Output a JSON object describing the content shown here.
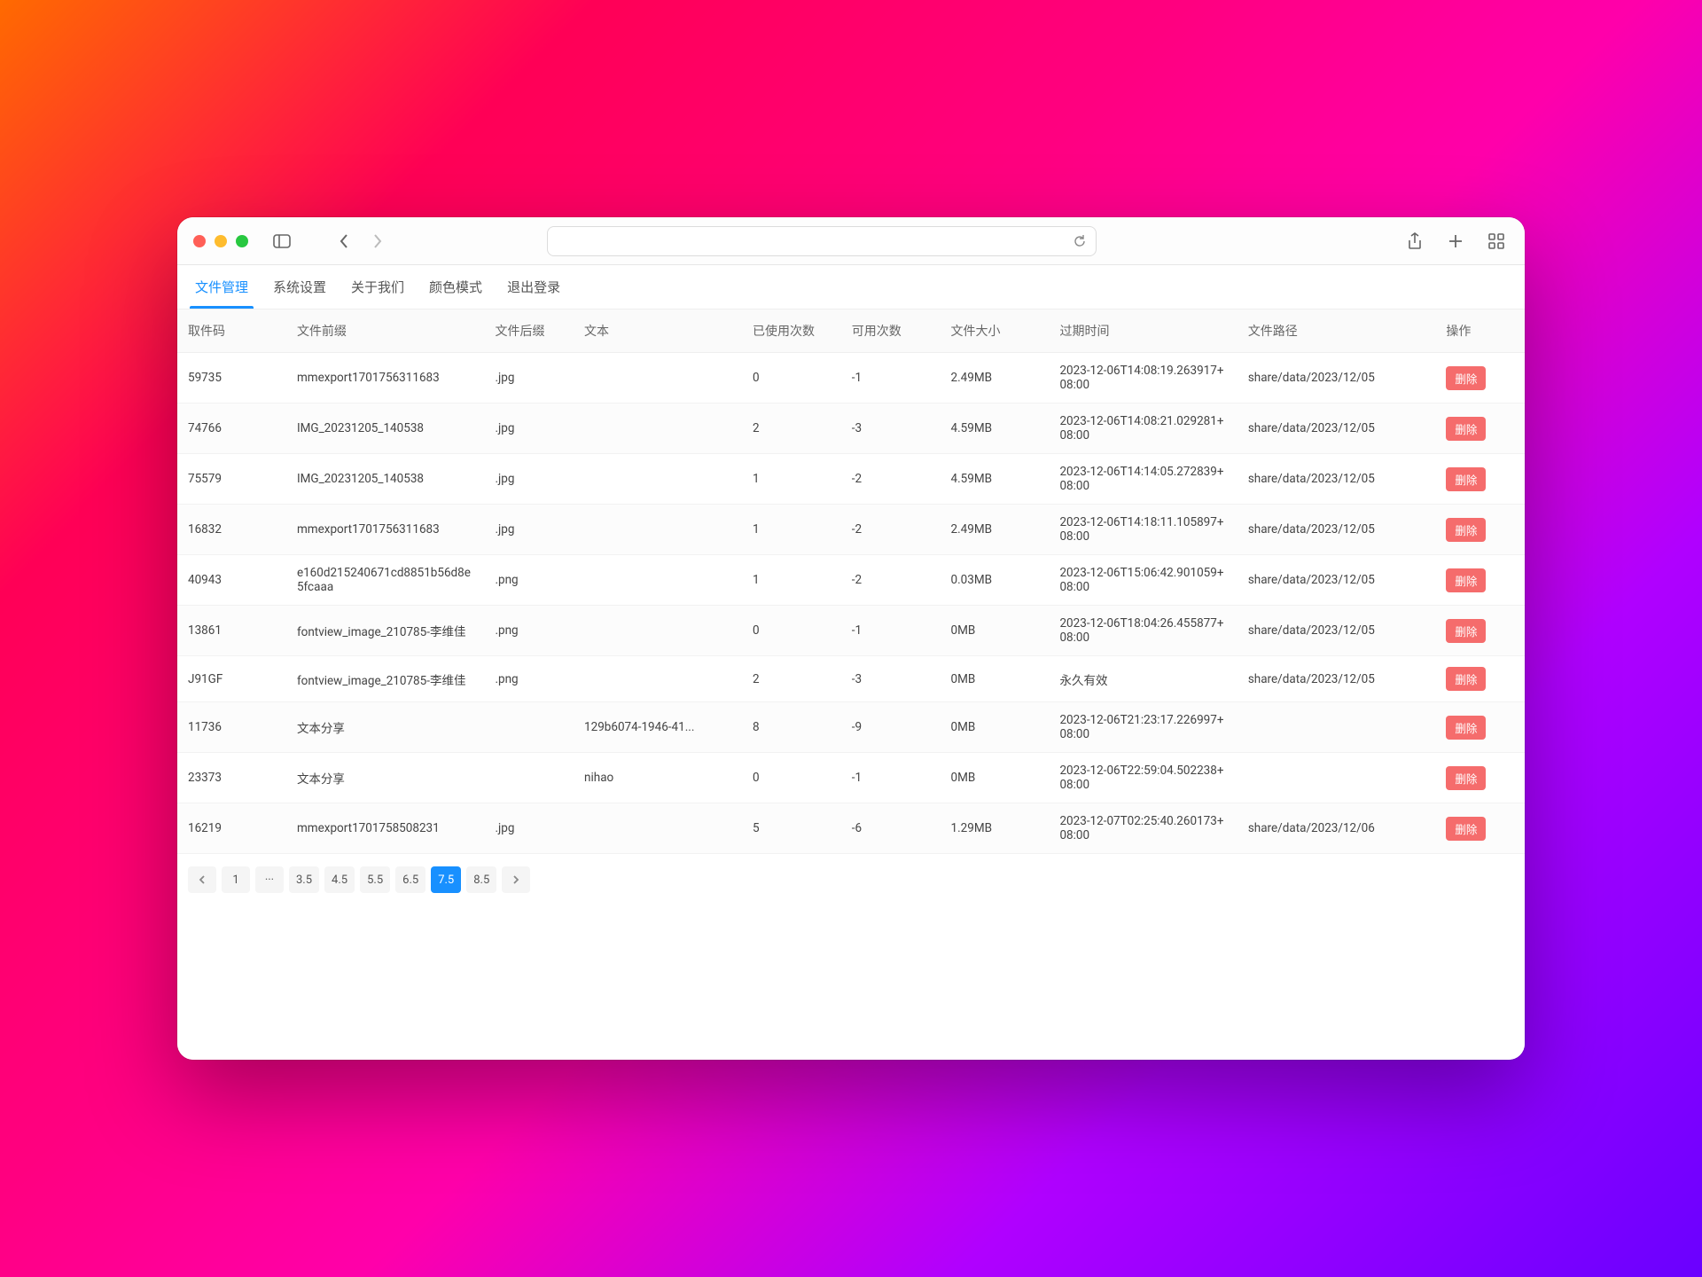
{
  "tabs": [
    "文件管理",
    "系统设置",
    "关于我们",
    "颜色模式",
    "退出登录"
  ],
  "active_tab": 0,
  "columns": [
    "取件码",
    "文件前缀",
    "文件后缀",
    "文本",
    "已使用次数",
    "可用次数",
    "文件大小",
    "过期时间",
    "文件路径",
    "操作"
  ],
  "delete_label": "删除",
  "rows": [
    {
      "code": "59735",
      "prefix": "mmexport1701756311683",
      "suffix": ".jpg",
      "text": "",
      "used": "0",
      "avail": "-1",
      "size": "2.49MB",
      "expires": "2023-12-06T14:08:19.263917+08:00",
      "path": "share/data/2023/12/05"
    },
    {
      "code": "74766",
      "prefix": "IMG_20231205_140538",
      "suffix": ".jpg",
      "text": "",
      "used": "2",
      "avail": "-3",
      "size": "4.59MB",
      "expires": "2023-12-06T14:08:21.029281+08:00",
      "path": "share/data/2023/12/05"
    },
    {
      "code": "75579",
      "prefix": "IMG_20231205_140538",
      "suffix": ".jpg",
      "text": "",
      "used": "1",
      "avail": "-2",
      "size": "4.59MB",
      "expires": "2023-12-06T14:14:05.272839+08:00",
      "path": "share/data/2023/12/05"
    },
    {
      "code": "16832",
      "prefix": "mmexport1701756311683",
      "suffix": ".jpg",
      "text": "",
      "used": "1",
      "avail": "-2",
      "size": "2.49MB",
      "expires": "2023-12-06T14:18:11.105897+08:00",
      "path": "share/data/2023/12/05"
    },
    {
      "code": "40943",
      "prefix": "e160d215240671cd8851b56d8e5fcaaa",
      "suffix": ".png",
      "text": "",
      "used": "1",
      "avail": "-2",
      "size": "0.03MB",
      "expires": "2023-12-06T15:06:42.901059+08:00",
      "path": "share/data/2023/12/05"
    },
    {
      "code": "13861",
      "prefix": "fontview_image_210785-李维佳",
      "suffix": ".png",
      "text": "",
      "used": "0",
      "avail": "-1",
      "size": "0MB",
      "expires": "2023-12-06T18:04:26.455877+08:00",
      "path": "share/data/2023/12/05"
    },
    {
      "code": "J91GF",
      "prefix": "fontview_image_210785-李维佳",
      "suffix": ".png",
      "text": "",
      "used": "2",
      "avail": "-3",
      "size": "0MB",
      "expires": "永久有效",
      "path": "share/data/2023/12/05"
    },
    {
      "code": "11736",
      "prefix": "文本分享",
      "suffix": "",
      "text": "129b6074-1946-41...",
      "used": "8",
      "avail": "-9",
      "size": "0MB",
      "expires": "2023-12-06T21:23:17.226997+08:00",
      "path": ""
    },
    {
      "code": "23373",
      "prefix": "文本分享",
      "suffix": "",
      "text": "nihao",
      "used": "0",
      "avail": "-1",
      "size": "0MB",
      "expires": "2023-12-06T22:59:04.502238+08:00",
      "path": ""
    },
    {
      "code": "16219",
      "prefix": "mmexport1701758508231",
      "suffix": ".jpg",
      "text": "",
      "used": "5",
      "avail": "-6",
      "size": "1.29MB",
      "expires": "2023-12-07T02:25:40.260173+08:00",
      "path": "share/data/2023/12/06"
    }
  ],
  "pagination": {
    "items": [
      {
        "label": "1",
        "active": false
      },
      {
        "label": "···",
        "active": false,
        "ellipsis": true
      },
      {
        "label": "3.5",
        "active": false
      },
      {
        "label": "4.5",
        "active": false
      },
      {
        "label": "5.5",
        "active": false
      },
      {
        "label": "6.5",
        "active": false
      },
      {
        "label": "7.5",
        "active": true
      },
      {
        "label": "8.5",
        "active": false
      }
    ]
  }
}
